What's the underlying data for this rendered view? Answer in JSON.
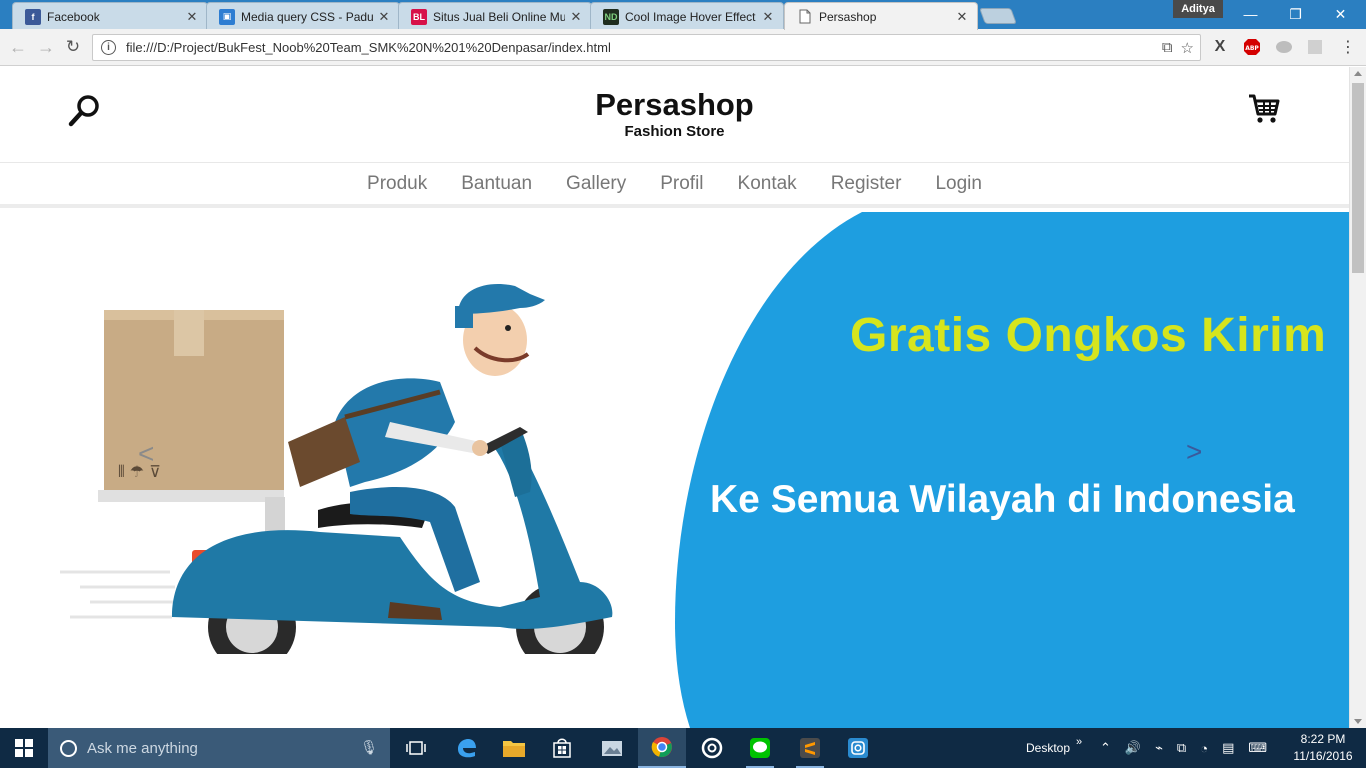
{
  "browser": {
    "tabs": [
      {
        "title": "Facebook",
        "icon": "facebook-icon",
        "color": "#3b5998",
        "glyph": "f"
      },
      {
        "title": "Media query CSS - Paduan",
        "icon": "media-query-icon",
        "color": "#2d7dd2",
        "glyph": ""
      },
      {
        "title": "Situs Jual Beli Online Mu",
        "icon": "bukalapak-icon",
        "color": "#d71149",
        "glyph": "BL"
      },
      {
        "title": "Cool Image Hover Effect",
        "icon": "nd-icon",
        "color": "#1f2d1f",
        "glyph": "ND"
      },
      {
        "title": "Persashop",
        "icon": "page-icon",
        "color": "#ffffff",
        "glyph": ""
      }
    ],
    "user": "Aditya",
    "url": "file:///D:/Project/BukFest_Noob%20Team_SMK%20N%201%20Denpasar/index.html"
  },
  "site": {
    "title": "Persashop",
    "subtitle": "Fashion Store",
    "nav": [
      "Produk",
      "Bantuan",
      "Gallery",
      "Profil",
      "Kontak",
      "Register",
      "Login"
    ],
    "hero": {
      "headline": "Gratis Ongkos Kirim",
      "subline": "Ke Semua Wilayah di Indonesia",
      "prev": "<",
      "next": ">"
    }
  },
  "colors": {
    "hero_blue": "#1e9ee0",
    "hero_yellow": "#d6e51d",
    "taskbar": "#0f2a44"
  },
  "taskbar": {
    "search_placeholder": "Ask me anything",
    "desktop_label": "Desktop",
    "time": "8:22 PM",
    "date": "11/16/2016"
  }
}
